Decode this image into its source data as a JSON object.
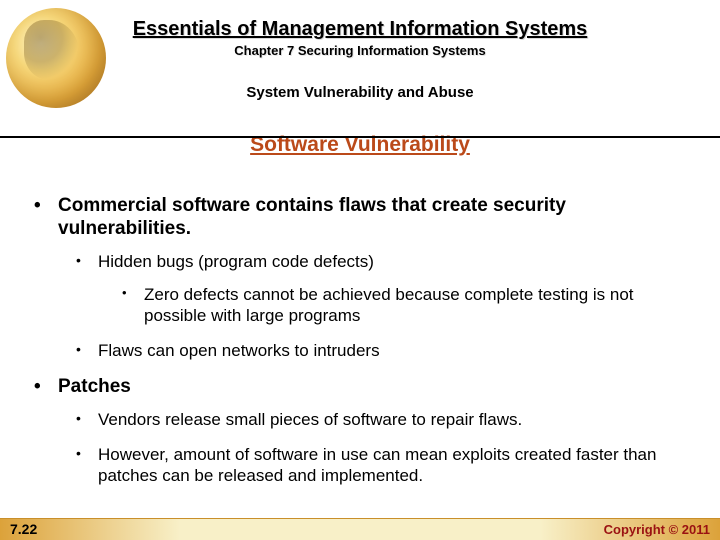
{
  "header": {
    "title": "Essentials of Management Information Systems",
    "chapter": "Chapter 7 Securing Information Systems",
    "section": "System Vulnerability and Abuse"
  },
  "slide_title": "Software Vulnerability",
  "bullets": {
    "b1": "Commercial software contains flaws that create security vulnerabilities.",
    "b1a": "Hidden bugs (program code defects)",
    "b1a1": "Zero defects cannot be achieved because complete testing is not possible with large programs",
    "b1b": "Flaws can open networks to intruders",
    "b2": "Patches",
    "b2a": "Vendors release small pieces of software to repair flaws.",
    "b2b": "However, amount of software in use can mean exploits created faster than patches can be released and implemented."
  },
  "footer": {
    "page": "7.22",
    "copyright": "Copyright © 2011"
  }
}
